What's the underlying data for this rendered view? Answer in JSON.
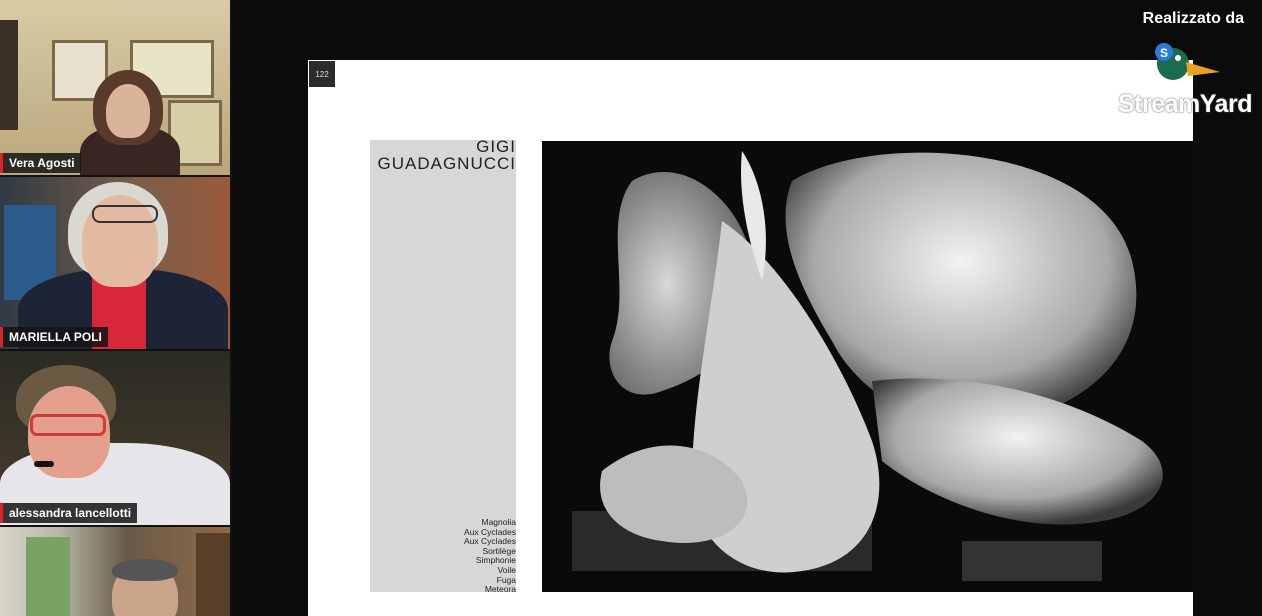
{
  "participants": [
    {
      "name": "Vera Agosti"
    },
    {
      "name": "MARIELLA POLI"
    },
    {
      "name": "alessandra lancellotti"
    },
    {
      "name": ""
    }
  ],
  "slide": {
    "page_number": "122",
    "artist_line1": "GIGI",
    "artist_line2": "GUADAGNUCCI",
    "works": [
      "Magnolia",
      "Aux Cyclades",
      "Aux Cyclades",
      "Sortilège",
      "Simphonie",
      "Voile",
      "Fuga",
      "Meteora"
    ]
  },
  "overlay": {
    "credit": "Realizzato da",
    "brand": "StreamYard",
    "logo_icon": "duck-s-icon"
  },
  "colors": {
    "name_accent": "#d9232d"
  }
}
